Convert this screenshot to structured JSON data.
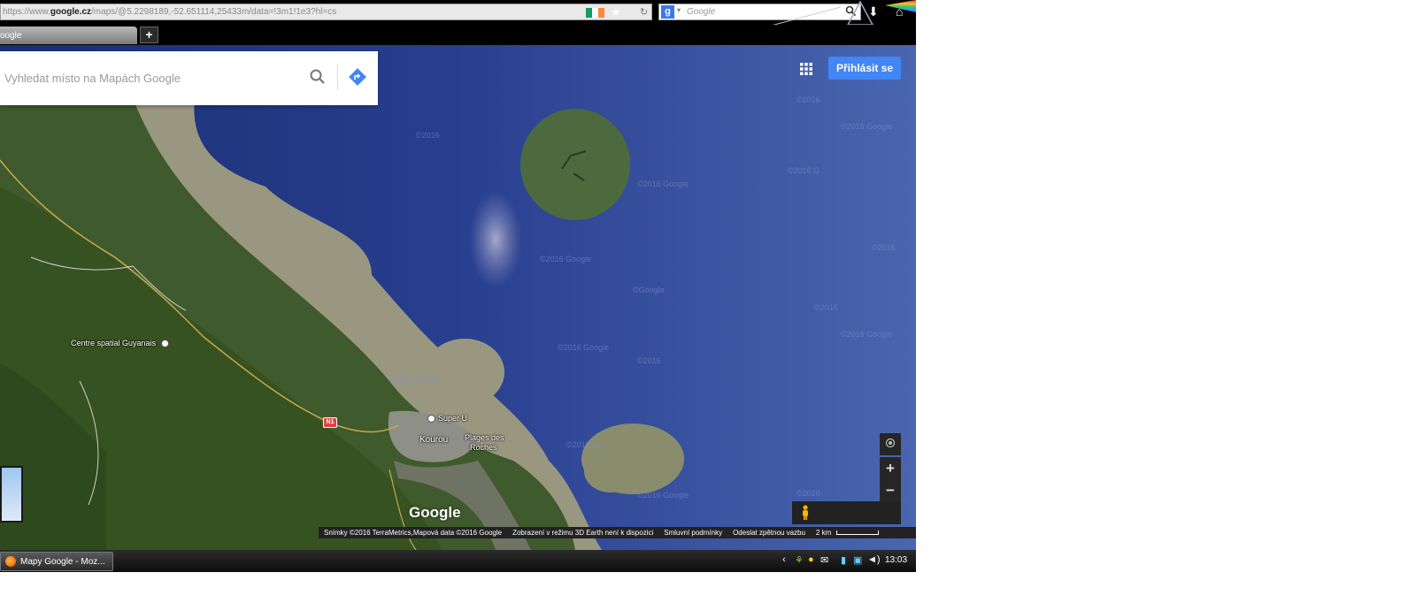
{
  "browser": {
    "url_prefix": "https://www.",
    "url_domain": "google.cz",
    "url_rest": "/maps/@5.2298189,-52.651114,25433m/data=!3m1!1e3?hl=cs",
    "search_engine_placeholder": "Google",
    "tab_title": "oogle",
    "new_tab_label": "+",
    "icons": [
      "ireland-flag-icon",
      "star-icon",
      "reload-icon",
      "google-search-badge-icon",
      "magnifier-icon",
      "download-icon",
      "home-icon"
    ],
    "flag_colors": [
      "#169b62",
      "#ffffff",
      "#ff883e"
    ]
  },
  "maps": {
    "search_placeholder": "Vyhledat místo na Mapách Google",
    "sign_in_label": "Přihlásit se",
    "logo_text": "Google",
    "labels": {
      "space_center": "Centre spatial Guyanais",
      "supermarket": "Super U",
      "town": "Kourou",
      "beach_line1": "Plages des",
      "beach_line2": "Roches",
      "road_shield": "N1"
    },
    "zoom_in_label": "+",
    "zoom_out_label": "−",
    "accent_color": "#4285f4",
    "attribution": {
      "imagery": "Snímky ©2016 TerraMetrics,Mapová data ©2016 Google",
      "earth_note": "Zobrazení v režimu 3D Earth není k dispozici",
      "terms": "Smluvní podmínky",
      "feedback": "Odeslat zpětnou vazbu",
      "scale": "2 km"
    }
  },
  "taskbar": {
    "window_title": "Mapy Google - Moz...",
    "clock": "13:03"
  }
}
